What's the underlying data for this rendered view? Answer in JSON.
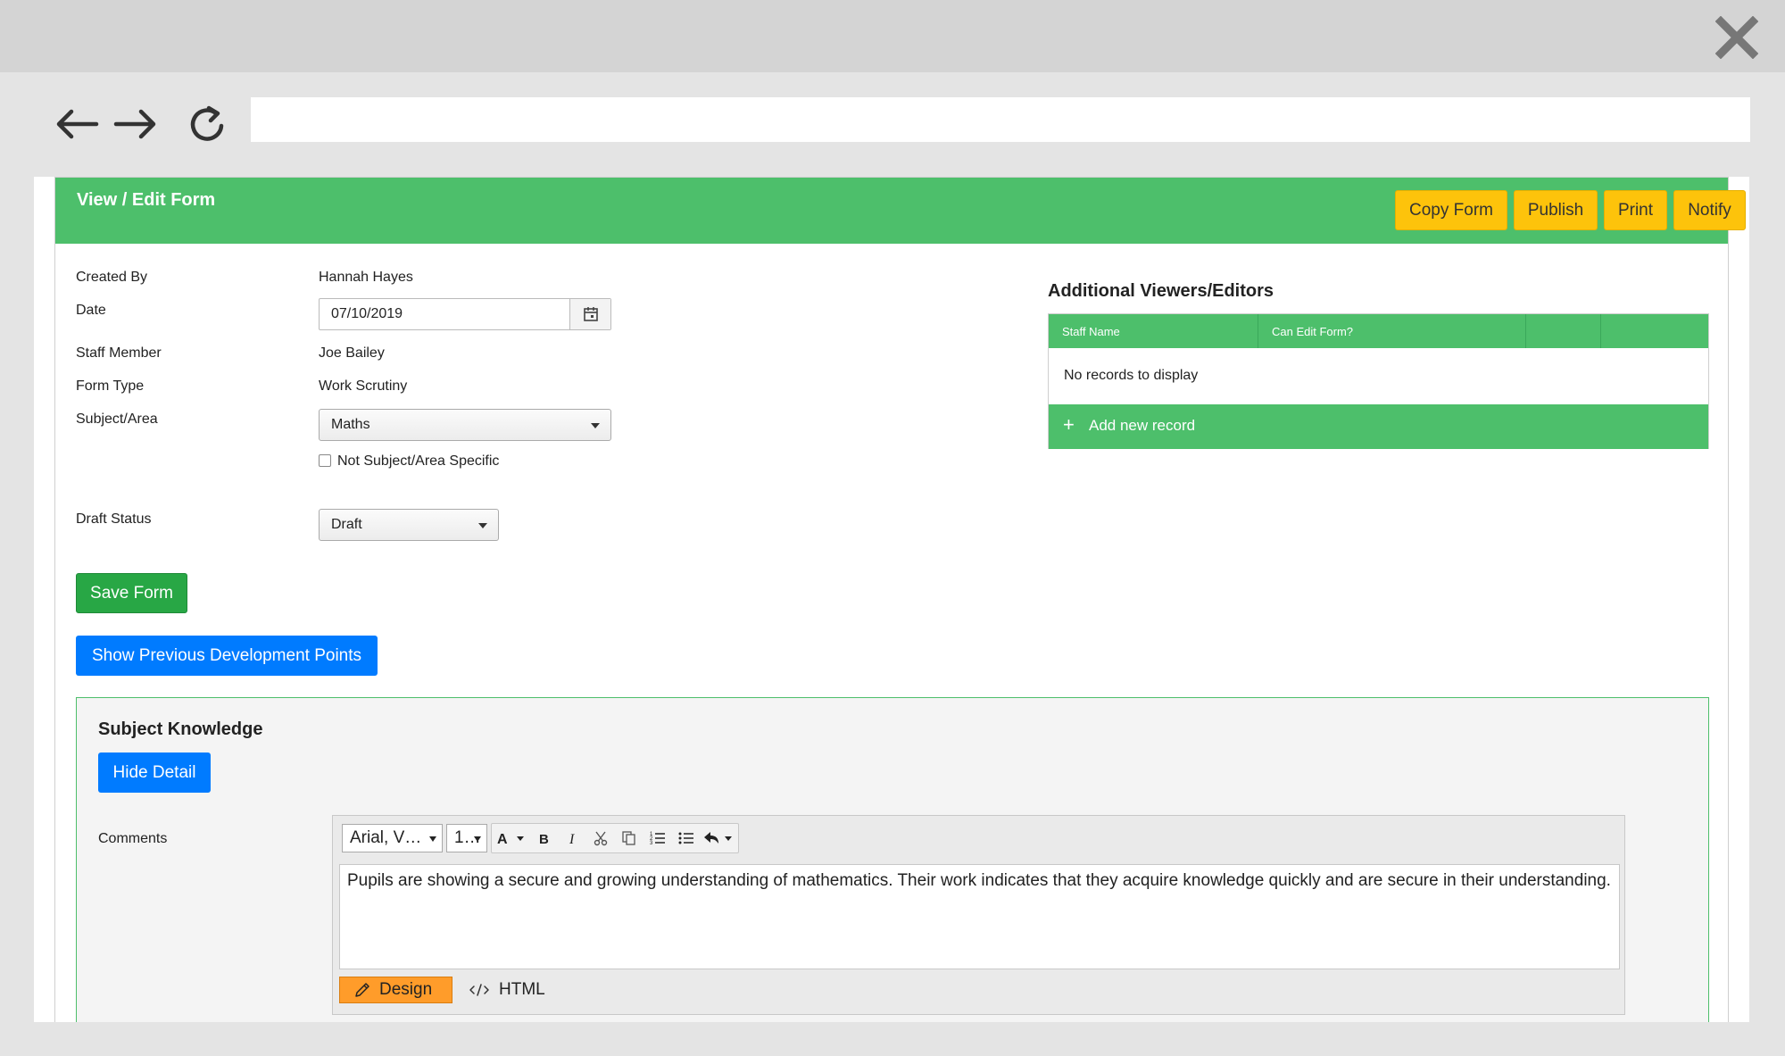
{
  "browser": {
    "address": ""
  },
  "header": {
    "title": "View / Edit Form",
    "buttons": {
      "copy": "Copy Form",
      "publish": "Publish",
      "print": "Print",
      "notify": "Notify"
    }
  },
  "form": {
    "created_by_label": "Created By",
    "created_by_value": "Hannah Hayes",
    "date_label": "Date",
    "date_value": "07/10/2019",
    "staff_label": "Staff Member",
    "staff_value": "Joe Bailey",
    "form_type_label": "Form Type",
    "form_type_value": "Work Scrutiny",
    "subject_label": "Subject/Area",
    "subject_value": "Maths",
    "not_specific_label": "Not Subject/Area Specific",
    "draft_label": "Draft Status",
    "draft_value": "Draft",
    "save_label": "Save Form",
    "show_prev_label": "Show Previous Development Points"
  },
  "viewers": {
    "title": "Additional Viewers/Editors",
    "columns": [
      "Staff Name",
      "Can Edit Form?",
      "",
      ""
    ],
    "empty": "No records to display",
    "add_label": "Add new record"
  },
  "section": {
    "title": "Subject Knowledge",
    "hide_label": "Hide Detail",
    "comments_label": "Comments",
    "editor": {
      "font": "Arial, V…",
      "size": "1…",
      "text": "Pupils are showing a secure and growing understanding of mathematics. Their work indicates that they acquire knowledge quickly and are secure in their understanding.",
      "design_label": "Design",
      "html_label": "HTML"
    }
  },
  "icons": [
    "close-icon",
    "back-arrow-icon",
    "forward-arrow-icon",
    "reload-icon",
    "calendar-icon",
    "plus-icon",
    "bold-icon",
    "italic-icon",
    "cut-icon",
    "copy-icon",
    "ordered-list-icon",
    "unordered-list-icon",
    "undo-icon",
    "pencil-icon",
    "code-icon"
  ],
  "colors": {
    "header_green": "#4dbf6b",
    "header_button": "#fdc30b",
    "save_green": "#28a745",
    "primary_blue": "#007bff",
    "design_orange": "#ff9c2a"
  }
}
